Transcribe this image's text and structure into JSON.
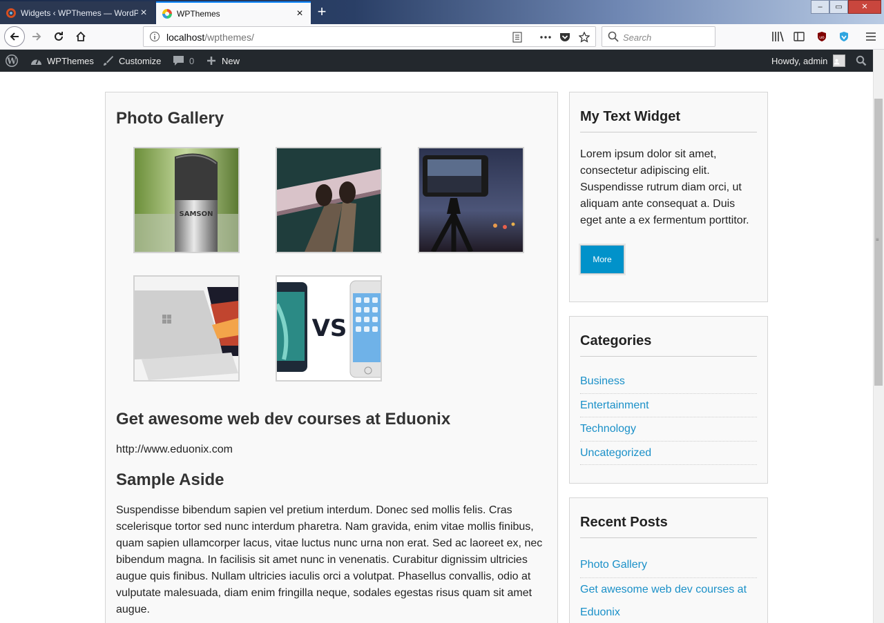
{
  "browser": {
    "tabs": [
      {
        "title": "Widgets ‹ WPThemes — WordPress",
        "active": false
      },
      {
        "title": "WPThemes",
        "active": true
      }
    ],
    "url_host": "localhost",
    "url_path": "/wpthemes/",
    "search_placeholder": "Search"
  },
  "adminbar": {
    "site_name": "WPThemes",
    "customize": "Customize",
    "comments_count": "0",
    "new_label": "New",
    "howdy": "Howdy, admin"
  },
  "main": {
    "gallery_title": "Photo Gallery",
    "gallery_images": [
      {
        "name": "microphone-photo",
        "text": "SAMSON"
      },
      {
        "name": "feet-on-rail-photo"
      },
      {
        "name": "phone-tripod-photo"
      },
      {
        "name": "laptop-photo"
      },
      {
        "name": "phones-vs-photo",
        "text": "VS"
      }
    ],
    "link_post_title": "Get awesome web dev courses at Eduonix",
    "link_post_url": "http://www.eduonix.com",
    "aside_title": "Sample Aside",
    "aside_text": "Suspendisse bibendum sapien vel pretium interdum. Donec sed mollis felis. Cras scelerisque tortor sed nunc interdum pharetra. Nam gravida, enim vitae mollis finibus, quam sapien ullamcorper lacus, vitae luctus nunc urna non erat. Sed ac laoreet ex, nec bibendum magna. In facilisis sit amet nunc in venenatis. Curabitur dignissim ultricies augue quis finibus. Nullam ultricies iaculis orci a volutpat. Phasellus convallis, odio at vulputate malesuada, diam enim fringilla neque, sodales egestas risus quam sit amet augue."
  },
  "sidebar": {
    "text_widget": {
      "title": "My Text Widget",
      "text": "Lorem ipsum dolor sit amet, consectetur adipiscing elit. Suspendisse rutrum diam orci, ut aliquam ante consequat a. Duis eget ante a ex fermentum porttitor.",
      "button": "More"
    },
    "categories": {
      "title": "Categories",
      "items": [
        "Business",
        "Entertainment",
        "Technology",
        "Uncategorized"
      ]
    },
    "recent_posts": {
      "title": "Recent Posts",
      "items": [
        "Photo Gallery",
        "Get awesome web dev courses at Eduonix"
      ]
    }
  },
  "colors": {
    "link": "#1a90c8",
    "button": "#0192ca",
    "adminbar": "#23282d"
  }
}
